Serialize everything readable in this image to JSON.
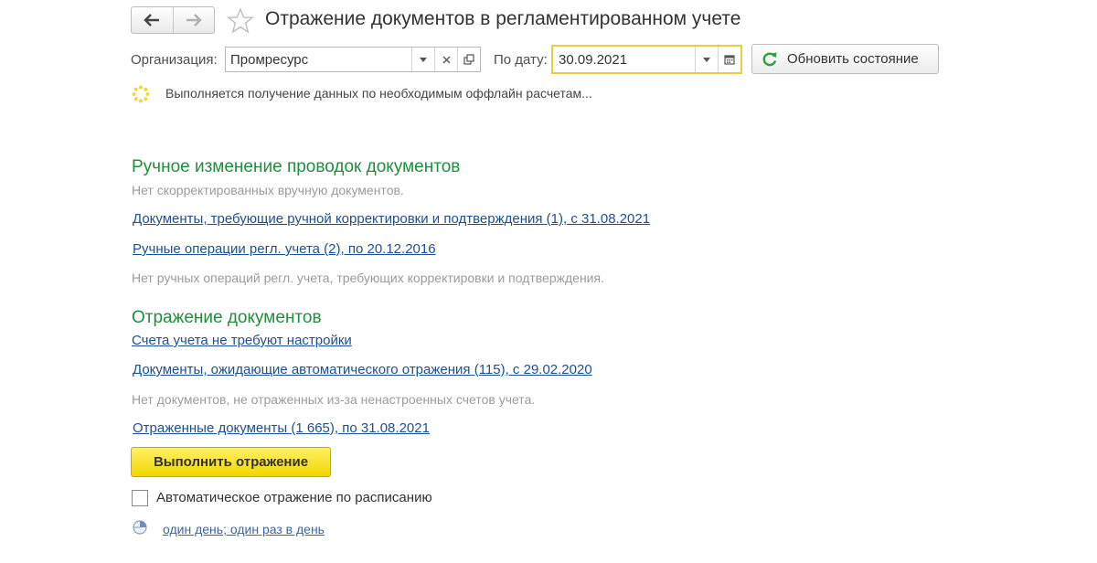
{
  "header": {
    "back_icon": "arrow-left-icon",
    "forward_icon": "arrow-right-icon",
    "favorite_icon": "star-icon",
    "title": "Отражение документов в регламентированном учете"
  },
  "filters": {
    "org_label": "Организация:",
    "org_value": "Промресурс",
    "date_label": "По дату:",
    "date_value": "30.09.2021",
    "refresh_label": "Обновить состояние"
  },
  "status": {
    "text": "Выполняется получение данных по необходимым оффлайн расчетам..."
  },
  "manual": {
    "heading": "Ручное изменение проводок документов",
    "note1": "Нет скорректированных вручную документов.",
    "link1": "Документы, требующие ручной корректировки и подтверждения (1), с 31.08.2021",
    "link2": "Ручные операции регл. учета (2), по 20.12.2016",
    "note2": "Нет ручных операций регл. учета, требующих корректировки и подтверждения."
  },
  "reflection": {
    "heading": "Отражение документов",
    "link1": "Счета учета не требуют настройки",
    "link2": "Документы, ожидающие автоматического отражения (115), с 29.02.2020",
    "note": "Нет документов, не отраженных из-за ненастроенных счетов учета.",
    "link3": "Отраженные документы (1 665), по 31.08.2021",
    "run_button": "Выполнить отражение",
    "auto_label": "Автоматическое отражение по расписанию",
    "auto_checked": false,
    "schedule_link": "один день; один раз в день"
  },
  "colors": {
    "heading_green": "#1f8f3c",
    "link_blue": "#1c4f94",
    "button_yellow": "#f5df1f",
    "date_focus": "#f0c93d"
  }
}
